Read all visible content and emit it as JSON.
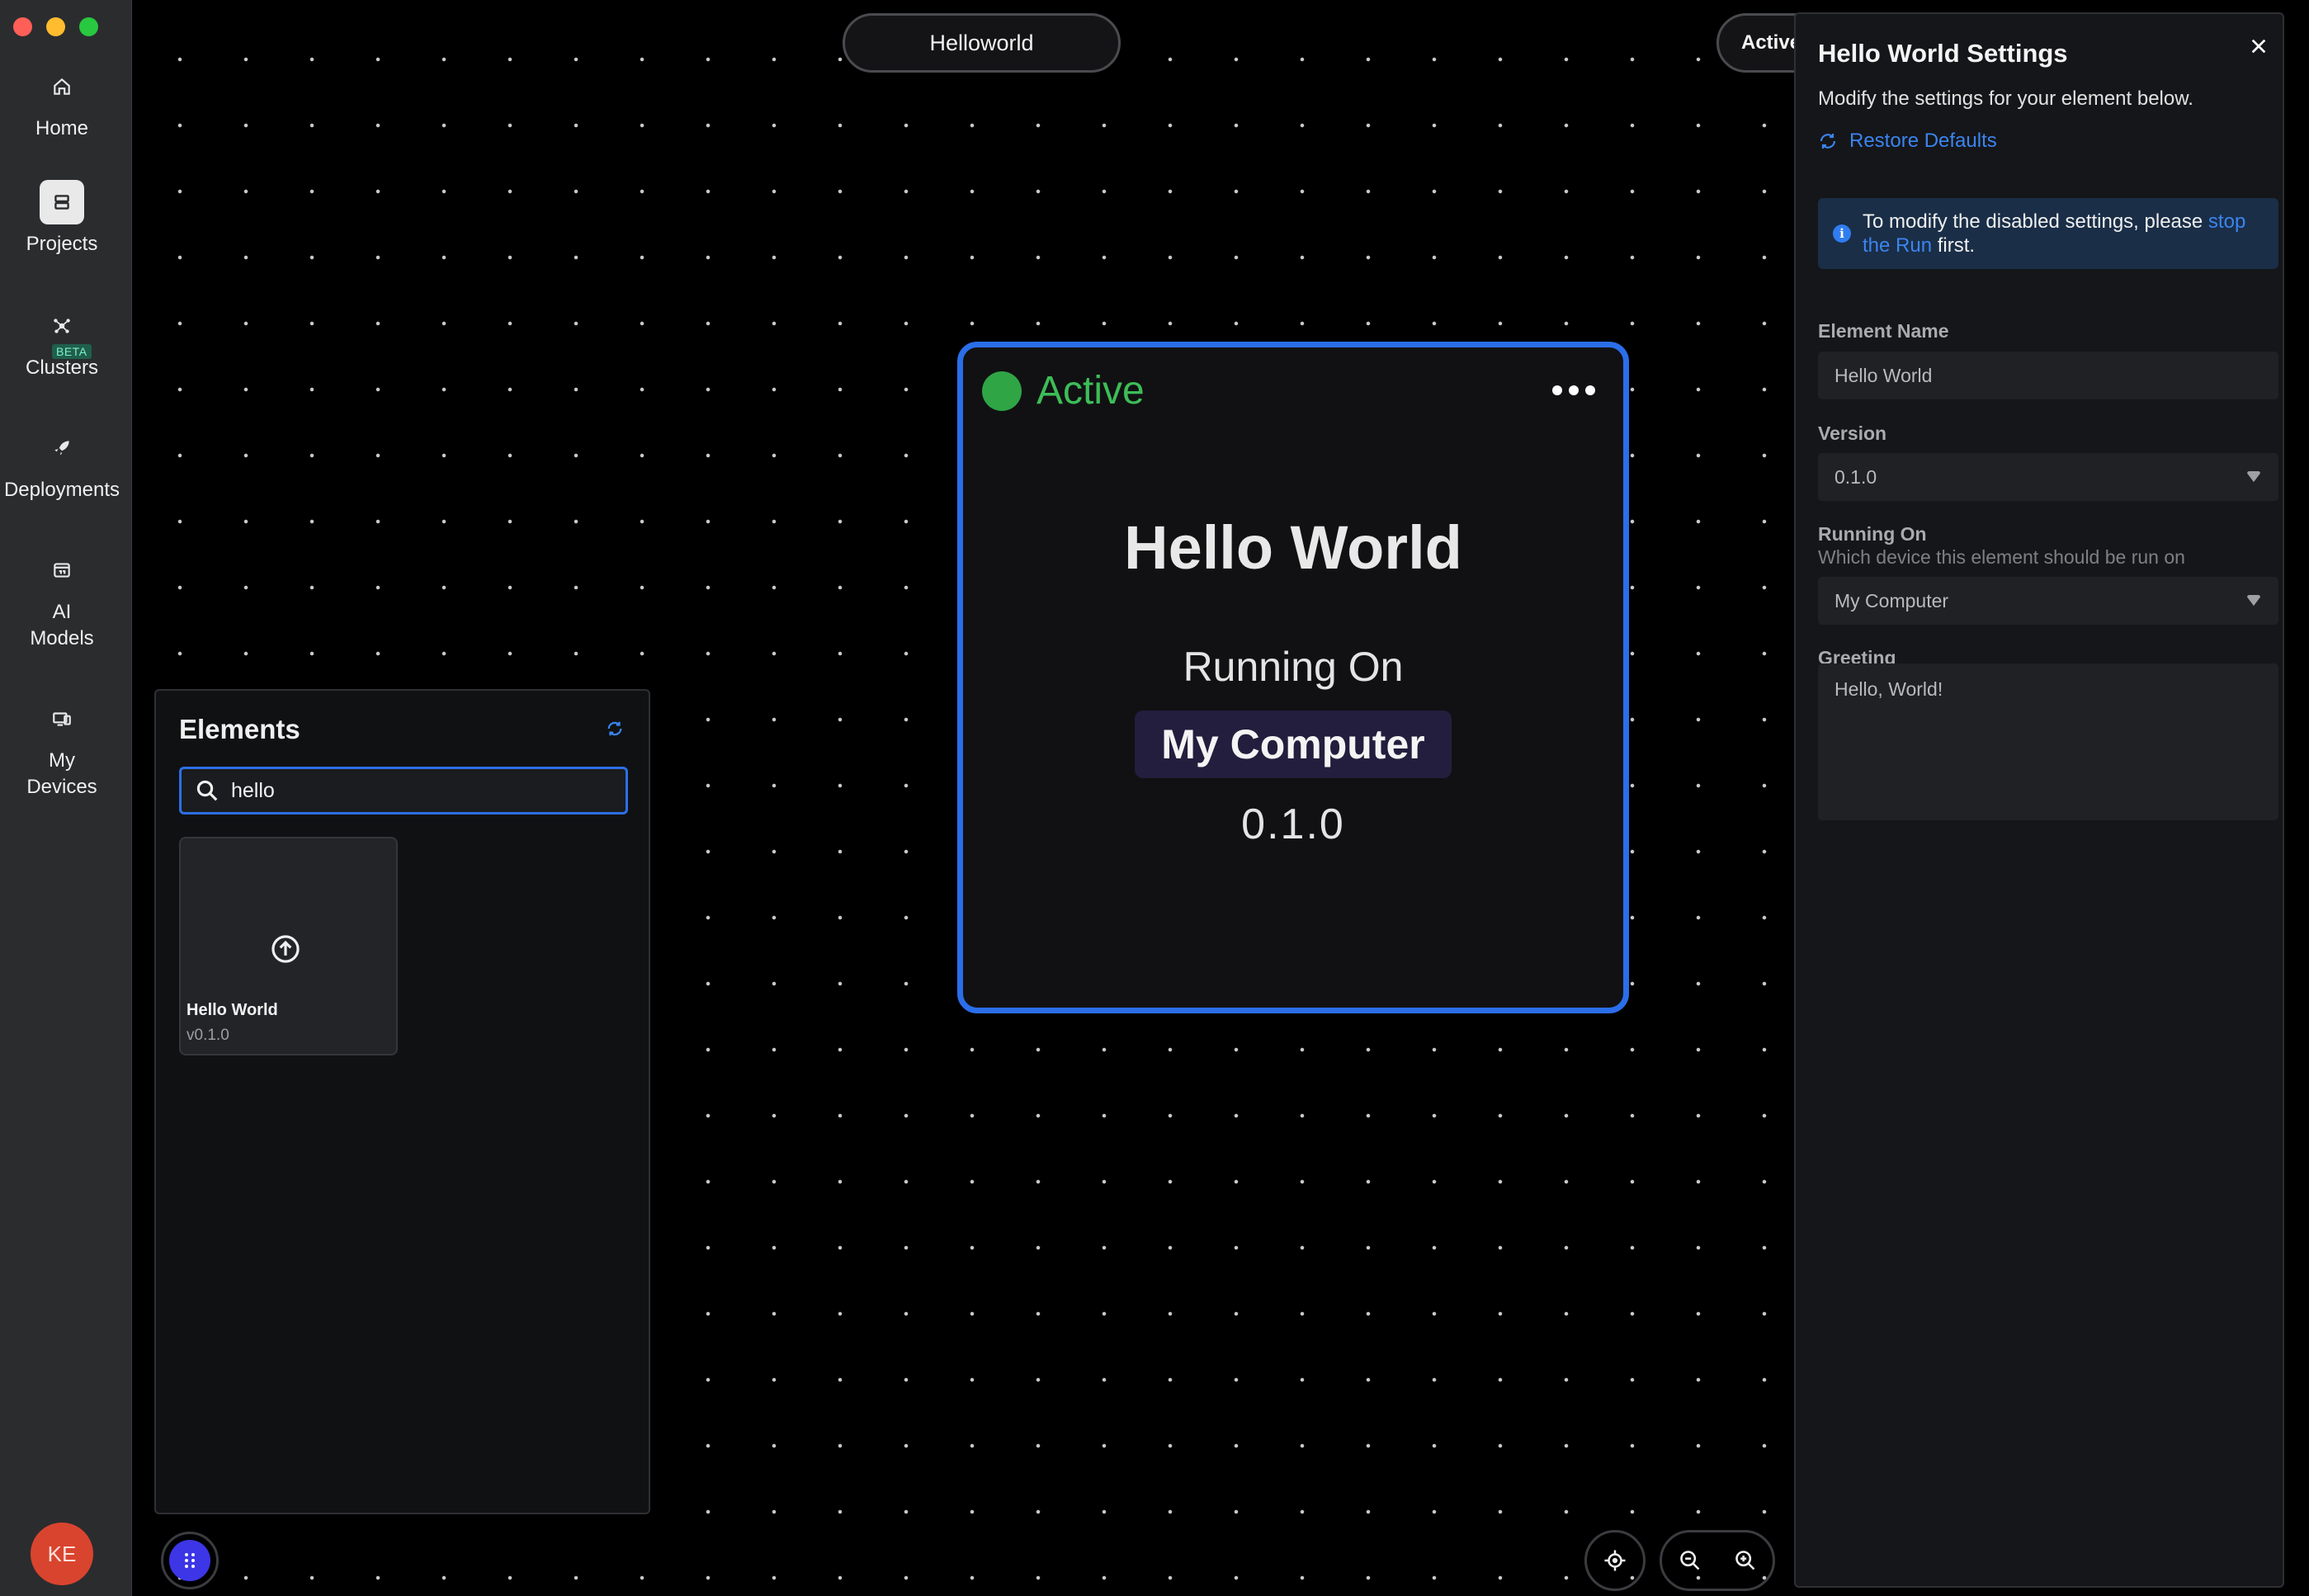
{
  "window": {
    "controls": [
      "close",
      "minimize",
      "zoom"
    ]
  },
  "sidebar": {
    "items": [
      {
        "id": "home",
        "label": "Home",
        "icon": "home-icon"
      },
      {
        "id": "projects",
        "label": "Projects",
        "icon": "projects-icon",
        "active": true
      },
      {
        "id": "clusters",
        "label": "Clusters",
        "icon": "clusters-icon",
        "badge": "BETA"
      },
      {
        "id": "deployments",
        "label": "Deployments",
        "icon": "rocket-icon"
      },
      {
        "id": "ai-models",
        "label": "AI Models",
        "label_lines": [
          "AI",
          "Models"
        ],
        "icon": "ai-models-icon"
      },
      {
        "id": "my-devices",
        "label": "My Devices",
        "label_lines": [
          "My",
          "Devices"
        ],
        "icon": "devices-icon"
      }
    ],
    "avatar_initials": "KE"
  },
  "canvas": {
    "project_name": "Helloworld",
    "run_status": {
      "label": "Active",
      "color": "#2f9b45"
    }
  },
  "element_card": {
    "status": "Active",
    "status_color": "#3dbd57",
    "title": "Hello World",
    "running_on_label": "Running On",
    "device": "My Computer",
    "version": "0.1.0",
    "border_color": "#2b6ee9"
  },
  "elements_panel": {
    "title": "Elements",
    "search_value": "hello",
    "results": [
      {
        "name": "Hello World",
        "version": "v0.1.0",
        "icon": "upload-icon"
      }
    ]
  },
  "settings": {
    "title": "Hello World Settings",
    "subtitle": "Modify the settings for your element below.",
    "restore_label": "Restore Defaults",
    "info": {
      "before": "To modify the disabled settings, please ",
      "link": "stop the Run",
      "after": " first."
    },
    "fields": {
      "element_name": {
        "label": "Element Name",
        "value": "Hello World"
      },
      "version": {
        "label": "Version",
        "value": "0.1.0"
      },
      "running_on": {
        "label": "Running On",
        "help": "Which device this element should be run on",
        "value": "My Computer"
      },
      "greeting": {
        "label": "Greeting",
        "value": "Hello, World!"
      }
    }
  },
  "colors": {
    "accent": "#2b6ee9",
    "link": "#3b85f0",
    "active_green": "#2fa546",
    "drawer_button": "#3c36e6"
  }
}
